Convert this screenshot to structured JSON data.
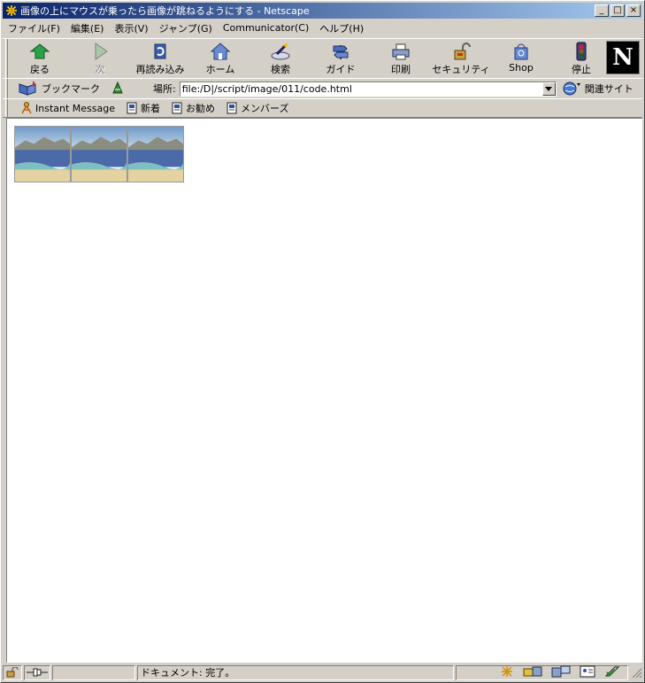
{
  "window": {
    "title": "画像の上にマウスが乗ったら画像が跳ねるようにする - Netscape",
    "minimize": "_",
    "maximize": "□",
    "close": "×"
  },
  "menu": [
    "ファイル(F)",
    "編集(E)",
    "表示(V)",
    "ジャンプ(G)",
    "Communicator(C)",
    "ヘルプ(H)"
  ],
  "toolbar": {
    "back": "戻る",
    "forward": "次",
    "reload": "再読み込み",
    "home": "ホーム",
    "search": "検索",
    "guide": "ガイド",
    "print": "印刷",
    "security": "セキュリティ",
    "shop": "Shop",
    "stop": "停止",
    "logo": "N"
  },
  "location": {
    "bookmarks": "ブックマーク",
    "label": "場所:",
    "url": "file:/D|/script/image/011/code.html",
    "related": "関連サイト"
  },
  "personal": {
    "instant_message": "Instant Message",
    "new": "新着",
    "recommend": "お勧め",
    "members": "メンバーズ"
  },
  "status": {
    "text": "ドキュメント: 完了。"
  },
  "colors": {
    "title_start": "#0a246a",
    "title_end": "#a6caf0",
    "chrome": "#d4d0c8"
  }
}
